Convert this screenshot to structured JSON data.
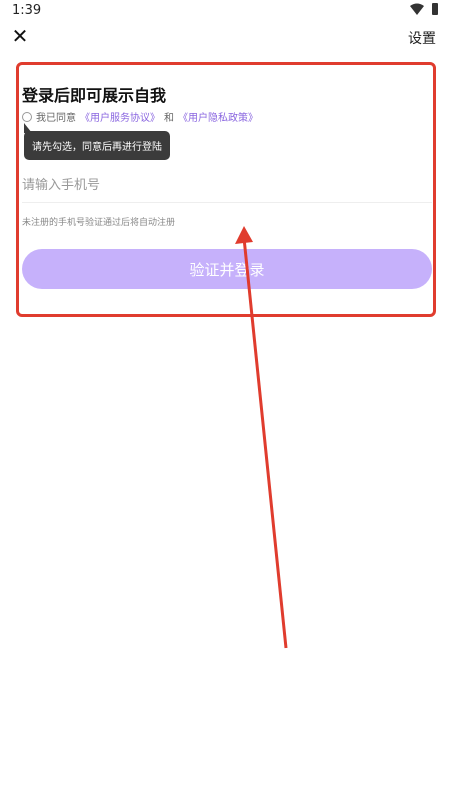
{
  "status_bar": {
    "time": "1:39"
  },
  "top_bar": {
    "settings_label": "设置"
  },
  "card": {
    "title": "登录后即可展示自我",
    "agree_prefix": "我已同意",
    "agree_link1": "《用户服务协议》",
    "agree_and": "和",
    "agree_link2": "《用户隐私政策》",
    "tooltip": "请先勾选，同意后再进行登陆",
    "phone_placeholder": "请输入手机号",
    "hint": "未注册的手机号验证通过后将自动注册",
    "submit_label": "验证并登录"
  },
  "colors": {
    "highlight_border": "#e03c2e",
    "accent_link": "#8a66e0",
    "button_bg": "#c6b1fb"
  }
}
